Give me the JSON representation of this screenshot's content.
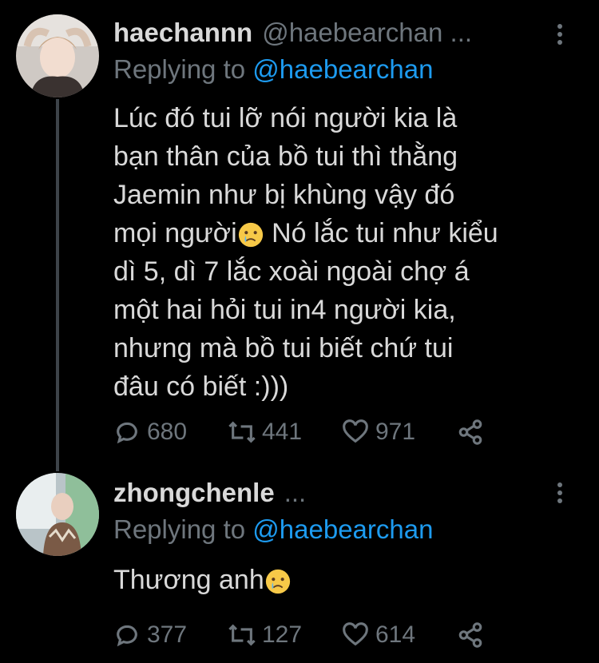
{
  "tweets": [
    {
      "display_name": "haechannn",
      "handle": "@haebearchan ...",
      "reply_prefix": "Replying to",
      "reply_to": "@haebearchan",
      "text_before_emoji": "Lúc đó tui lỡ nói người kia là\nbạn thân của bồ tui thì thằng\nJaemin như bị khùng vậy đó\nmọi người",
      "text_after_emoji": " Nó lắc tui như kiểu\ndì 5, dì 7 lắc xoài ngoài chợ á\nmột hai hỏi tui in4 người kia,\nnhưng mà bồ tui biết chứ tui\nđâu có biết :)))",
      "emoji": "crying-face",
      "replies": "680",
      "retweets": "441",
      "likes": "971"
    },
    {
      "display_name": "zhongchenle",
      "handle": "...",
      "reply_prefix": "Replying to",
      "reply_to": "@haebearchan",
      "text_before_emoji": "Thương anh",
      "text_after_emoji": "",
      "emoji": "crying-face",
      "replies": "377",
      "retweets": "127",
      "likes": "614"
    }
  ],
  "colors": {
    "background": "#000000",
    "text": "#d9d9d9",
    "muted": "#6e767d",
    "link": "#1d9bf0",
    "thread_line": "#3d4349"
  }
}
